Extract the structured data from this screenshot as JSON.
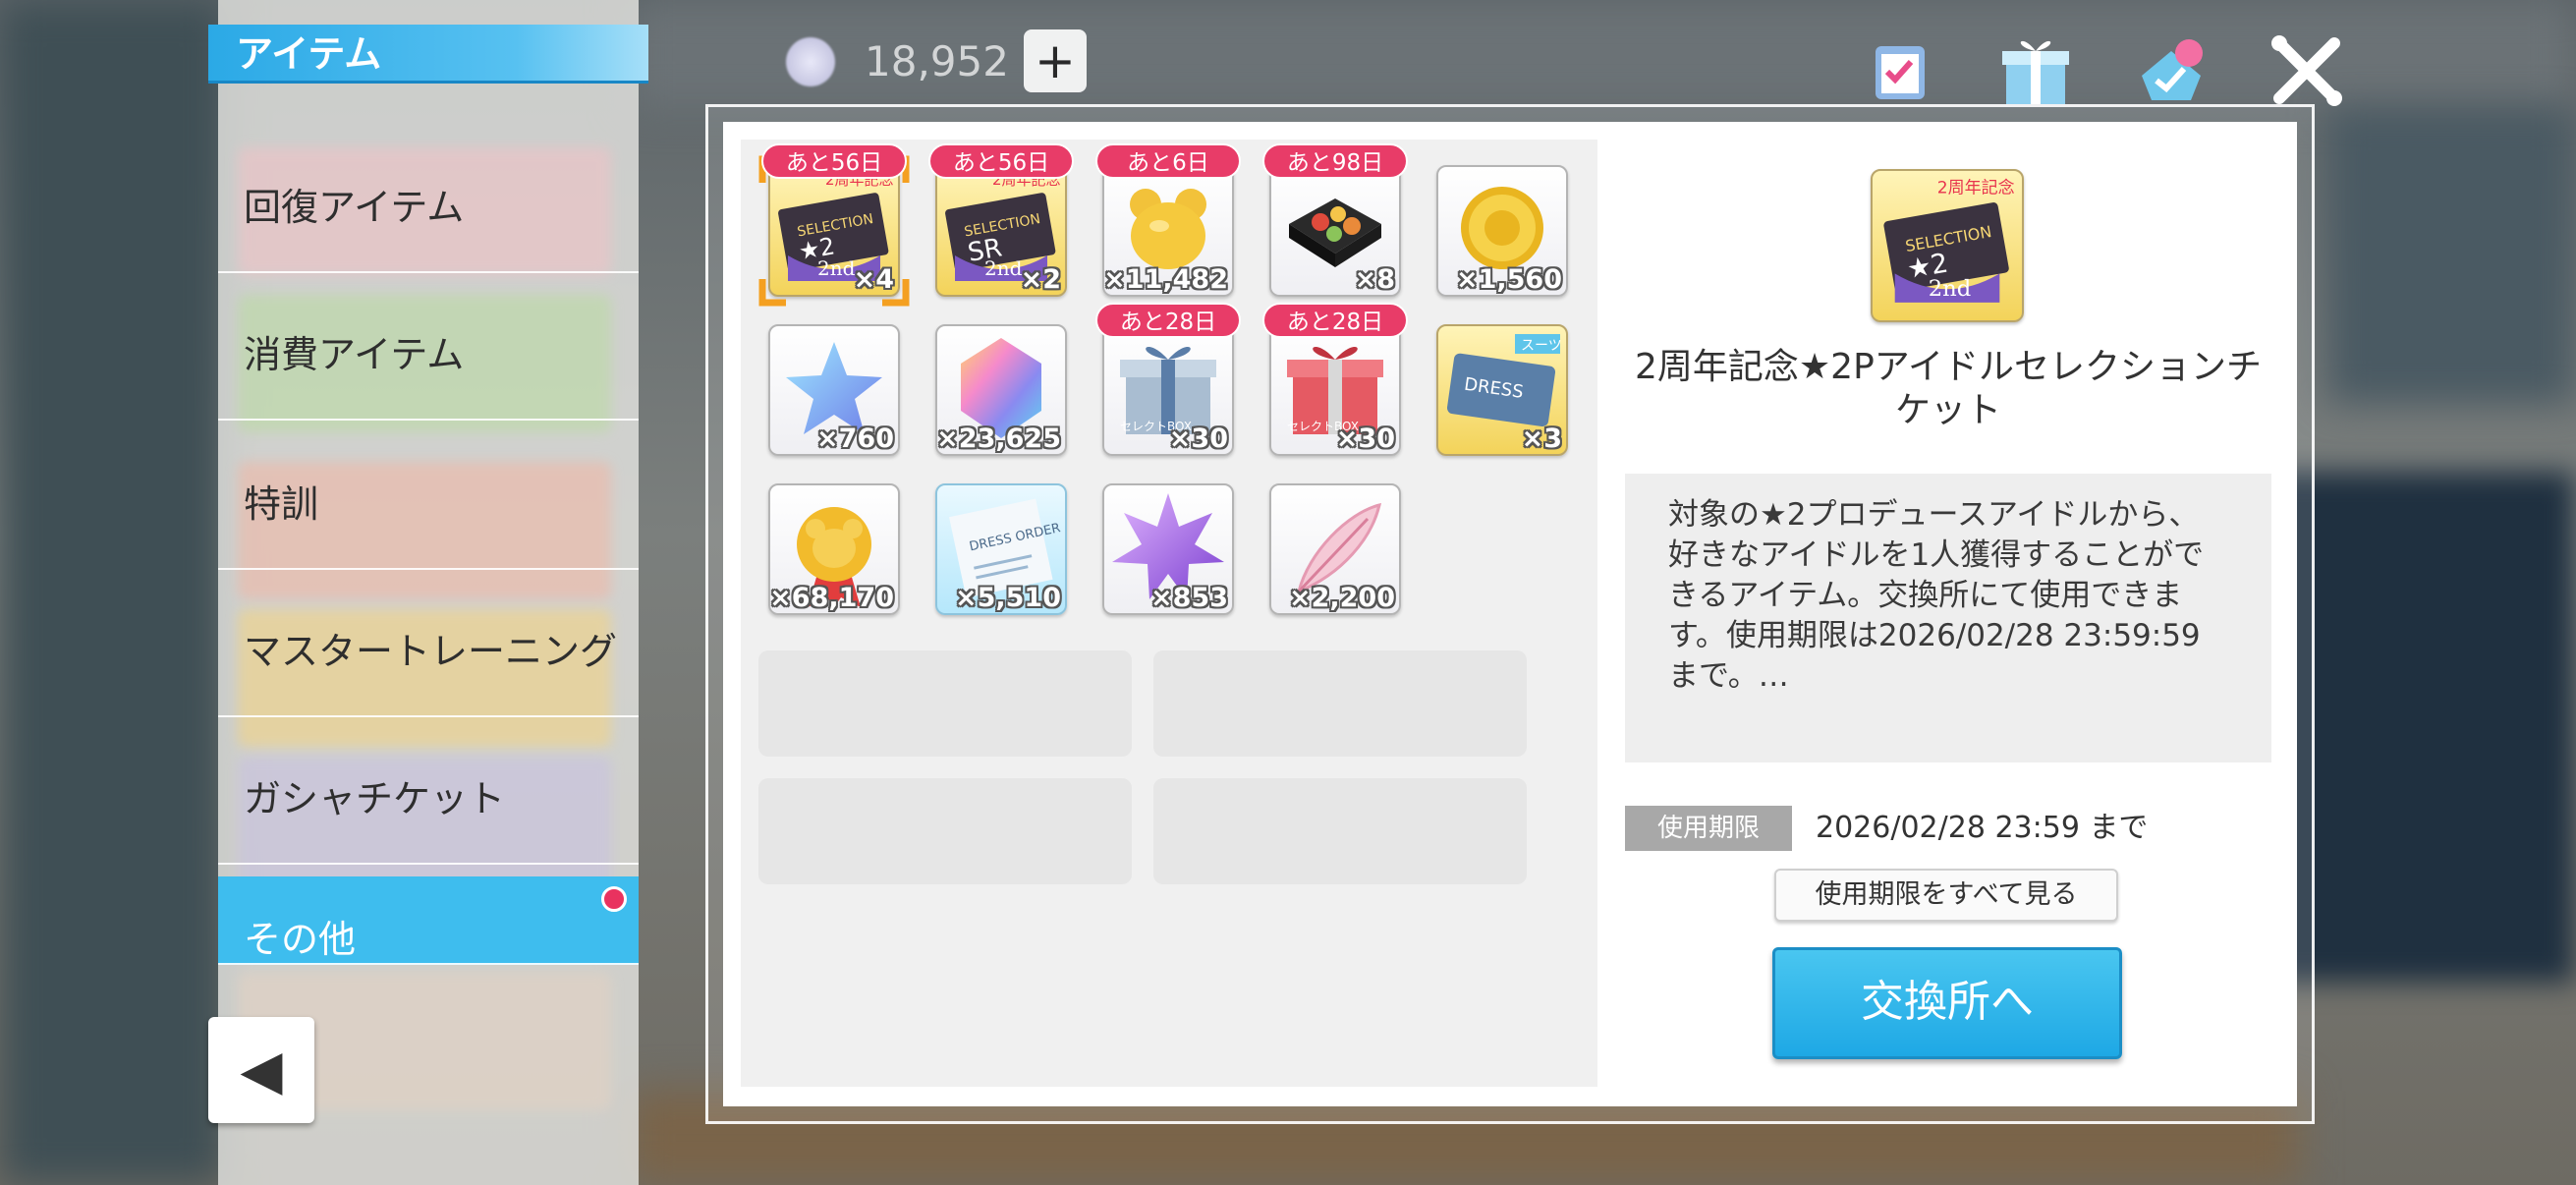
{
  "header": {
    "category_title": "アイテム",
    "currency_value": "18,952",
    "plus_label": "+"
  },
  "sidebar": {
    "items": [
      {
        "label": "回復アイテム"
      },
      {
        "label": "消費アイテム"
      },
      {
        "label": "特訓"
      },
      {
        "label": "マスタートレーニング"
      },
      {
        "label": "ガシャチケット"
      },
      {
        "label": "その他",
        "active": true
      }
    ],
    "back_label": "◀"
  },
  "items": [
    {
      "name": "2周年記念★2セレクションチケット",
      "count": "×4",
      "badge": "あと56日",
      "selected": true,
      "art": "ticket-2star"
    },
    {
      "name": "2周年記念SRセレクションチケット",
      "count": "×2",
      "badge": "あと56日",
      "art": "ticket-sr"
    },
    {
      "name": "ゴールドベア",
      "count": "×11,482",
      "badge": "あと6日",
      "art": "gold-bear"
    },
    {
      "name": "おせち",
      "count": "×8",
      "badge": "あと98日",
      "art": "osechi"
    },
    {
      "name": "シーズンメダル",
      "count": "×1,560",
      "art": "gold-medal"
    },
    {
      "name": "スター",
      "count": "×760",
      "art": "crystal-star"
    },
    {
      "name": "ジュエル",
      "count": "×23,625",
      "art": "jewel"
    },
    {
      "name": "セレクトBOX",
      "count": "×30",
      "badge": "あと28日",
      "art": "gift-silver",
      "label": "セレクトBOX"
    },
    {
      "name": "セレクトBOX",
      "count": "×30",
      "badge": "あと28日",
      "art": "gift-red",
      "label": "セレクトBOX"
    },
    {
      "name": "スーツ ドレスチケット",
      "count": "×3",
      "art": "dress-ticket",
      "tag": "スーツ",
      "tag_text": "DRESS"
    },
    {
      "name": "ベアメダル",
      "count": "×68,170",
      "art": "bear-medal"
    },
    {
      "name": "ドレスオーダー",
      "count": "×5,510",
      "art": "dress-order",
      "label": "DRESS ORDER"
    },
    {
      "name": "スターピース",
      "count": "×853",
      "art": "purple-star"
    },
    {
      "name": "フェザー",
      "count": "×2,200",
      "art": "feather"
    }
  ],
  "ticket_text": {
    "anniv": "2周年記念",
    "selection": "SELECTION",
    "star2": "★2",
    "sr": "SR",
    "second": "2nd"
  },
  "detail": {
    "title": "2周年記念★2Pアイドルセレクションチケット",
    "description": "対象の★2プロデュースアイドルから、好きなアイドルを1人獲得することができるアイテム。交換所にて使用できます。使用期限は2026/02/28 23:59:59まで。…",
    "expiry_label": "使用期限",
    "expiry_value": "2026/02/28 23:59 まで",
    "see_all_label": "使用期限をすべて見る",
    "exchange_label": "交換所へ"
  },
  "colors": {
    "accent_blue": "#2ba9e6",
    "badge_pink": "#e83c68",
    "notification_red": "#e9325f"
  }
}
